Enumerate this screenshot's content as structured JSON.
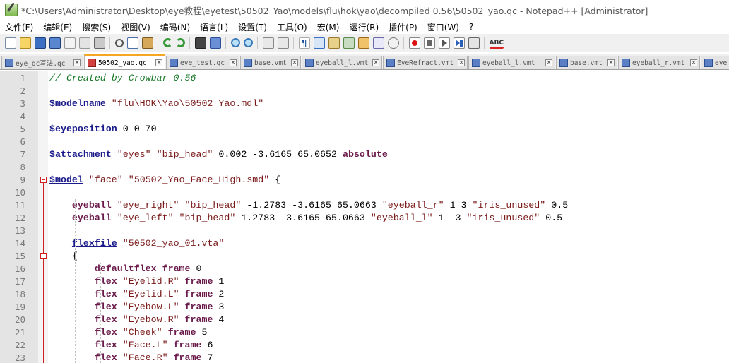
{
  "window": {
    "title": "*C:\\Users\\Administrator\\Desktop\\eye教程\\eyetest\\50502_Yao\\models\\flu\\hok\\yao\\decompiled 0.56\\50502_yao.qc - Notepad++ [Administrator]"
  },
  "menu": {
    "items": [
      "文件(F)",
      "编辑(E)",
      "搜索(S)",
      "视图(V)",
      "编码(N)",
      "语言(L)",
      "设置(T)",
      "工具(O)",
      "宏(M)",
      "运行(R)",
      "插件(P)",
      "窗口(W)",
      "?"
    ]
  },
  "toolbar": {
    "icons": [
      "new-file-icon",
      "open-file-icon",
      "save-icon",
      "save-all-icon",
      "close-icon",
      "close-all-icon",
      "print-icon",
      "cut-icon",
      "copy-icon",
      "paste-icon",
      "undo-icon",
      "redo-icon",
      "find-icon",
      "replace-icon",
      "zoom-in-icon",
      "zoom-out-icon",
      "sync-scroll-icon",
      "word-wrap-icon",
      "show-all-chars-icon",
      "indent-guide-icon",
      "folder-as-workspace-icon",
      "document-map-icon",
      "function-list-icon",
      "document-list-icon",
      "monitoring-icon",
      "record-macro-icon",
      "stop-recording-icon",
      "playback-macro-icon",
      "run-macro-multiple-icon",
      "save-macro-icon",
      "spell-check-icon"
    ],
    "spell_label": "ABC"
  },
  "tabs": [
    {
      "label": "eye_qc写法.qc",
      "active": false
    },
    {
      "label": "50502_yao.qc",
      "active": true
    },
    {
      "label": "eye_test.qc",
      "active": false
    },
    {
      "label": "base.vmt",
      "active": false
    },
    {
      "label": "eyeball_l.vmt",
      "active": false
    },
    {
      "label": "EyeRefract.vmt",
      "active": false
    },
    {
      "label": "eyeball_l.vmt",
      "active": false
    },
    {
      "label": "base.vmt",
      "active": false
    },
    {
      "label": "eyeball_r.vmt",
      "active": false
    },
    {
      "label": "eye",
      "active": false
    }
  ],
  "editor": {
    "lines": [
      {
        "n": "1",
        "tokens": [
          {
            "t": "// Created by Crowbar 0.56",
            "c": "comment"
          }
        ]
      },
      {
        "n": "2",
        "tokens": []
      },
      {
        "n": "3",
        "tokens": [
          {
            "t": "$modelname",
            "c": "dir"
          },
          {
            "t": " ",
            "c": "plain"
          },
          {
            "t": "\"flu\\HOK\\Yao\\50502_Yao.mdl\"",
            "c": "str"
          }
        ]
      },
      {
        "n": "4",
        "tokens": []
      },
      {
        "n": "5",
        "tokens": [
          {
            "t": "$eyeposition",
            "c": "dirnu"
          },
          {
            "t": " 0 0 70",
            "c": "num"
          }
        ]
      },
      {
        "n": "6",
        "tokens": []
      },
      {
        "n": "7",
        "tokens": [
          {
            "t": "$attachment",
            "c": "dirnu"
          },
          {
            "t": " ",
            "c": "plain"
          },
          {
            "t": "\"eyes\"",
            "c": "str"
          },
          {
            "t": " ",
            "c": "plain"
          },
          {
            "t": "\"bip_head\"",
            "c": "str"
          },
          {
            "t": " 0.002 -3.6165 65.0652 ",
            "c": "num"
          },
          {
            "t": "absolute",
            "c": "kw"
          }
        ]
      },
      {
        "n": "8",
        "tokens": []
      },
      {
        "n": "9",
        "tokens": [
          {
            "t": "$model",
            "c": "dir"
          },
          {
            "t": " ",
            "c": "plain"
          },
          {
            "t": "\"face\"",
            "c": "str"
          },
          {
            "t": " ",
            "c": "plain"
          },
          {
            "t": "\"50502_Yao_Face_High.smd\"",
            "c": "str"
          },
          {
            "t": " {",
            "c": "plain"
          }
        ]
      },
      {
        "n": "10",
        "tokens": []
      },
      {
        "n": "11",
        "tokens": [
          {
            "t": "    ",
            "c": "plain"
          },
          {
            "t": "eyeball",
            "c": "key"
          },
          {
            "t": " ",
            "c": "plain"
          },
          {
            "t": "\"eye_right\"",
            "c": "str"
          },
          {
            "t": " ",
            "c": "plain"
          },
          {
            "t": "\"bip_head\"",
            "c": "str"
          },
          {
            "t": " -1.2783 -3.6165 65.0663 ",
            "c": "num"
          },
          {
            "t": "\"eyeball_r\"",
            "c": "str"
          },
          {
            "t": " 1 3 ",
            "c": "num"
          },
          {
            "t": "\"iris_unused\"",
            "c": "str"
          },
          {
            "t": " 0.5",
            "c": "num"
          }
        ]
      },
      {
        "n": "12",
        "tokens": [
          {
            "t": "    ",
            "c": "plain"
          },
          {
            "t": "eyeball",
            "c": "key"
          },
          {
            "t": " ",
            "c": "plain"
          },
          {
            "t": "\"eye_left\"",
            "c": "str"
          },
          {
            "t": " ",
            "c": "plain"
          },
          {
            "t": "\"bip_head\"",
            "c": "str"
          },
          {
            "t": " 1.2783 -3.6165 65.0663 ",
            "c": "num"
          },
          {
            "t": "\"eyeball_l\"",
            "c": "str"
          },
          {
            "t": " 1 -3 ",
            "c": "num"
          },
          {
            "t": "\"iris_unused\"",
            "c": "str"
          },
          {
            "t": " 0.5",
            "c": "num"
          }
        ]
      },
      {
        "n": "13",
        "tokens": []
      },
      {
        "n": "14",
        "tokens": [
          {
            "t": "    ",
            "c": "plain"
          },
          {
            "t": "flexfile",
            "c": "dir"
          },
          {
            "t": " ",
            "c": "plain"
          },
          {
            "t": "\"50502_yao_01.vta\"",
            "c": "str"
          }
        ]
      },
      {
        "n": "15",
        "tokens": [
          {
            "t": "    {",
            "c": "plain"
          }
        ]
      },
      {
        "n": "16",
        "tokens": [
          {
            "t": "        ",
            "c": "plain"
          },
          {
            "t": "defaultflex",
            "c": "key"
          },
          {
            "t": " ",
            "c": "plain"
          },
          {
            "t": "frame",
            "c": "kw"
          },
          {
            "t": " 0",
            "c": "num"
          }
        ]
      },
      {
        "n": "17",
        "tokens": [
          {
            "t": "        ",
            "c": "plain"
          },
          {
            "t": "flex",
            "c": "key"
          },
          {
            "t": " ",
            "c": "plain"
          },
          {
            "t": "\"Eyelid.R\"",
            "c": "str"
          },
          {
            "t": " ",
            "c": "plain"
          },
          {
            "t": "frame",
            "c": "kw"
          },
          {
            "t": " 1",
            "c": "num"
          }
        ]
      },
      {
        "n": "18",
        "tokens": [
          {
            "t": "        ",
            "c": "plain"
          },
          {
            "t": "flex",
            "c": "key"
          },
          {
            "t": " ",
            "c": "plain"
          },
          {
            "t": "\"Eyelid.L\"",
            "c": "str"
          },
          {
            "t": " ",
            "c": "plain"
          },
          {
            "t": "frame",
            "c": "kw"
          },
          {
            "t": " 2",
            "c": "num"
          }
        ]
      },
      {
        "n": "19",
        "tokens": [
          {
            "t": "        ",
            "c": "plain"
          },
          {
            "t": "flex",
            "c": "key"
          },
          {
            "t": " ",
            "c": "plain"
          },
          {
            "t": "\"Eyebow.L\"",
            "c": "str"
          },
          {
            "t": " ",
            "c": "plain"
          },
          {
            "t": "frame",
            "c": "kw"
          },
          {
            "t": " 3",
            "c": "num"
          }
        ]
      },
      {
        "n": "20",
        "tokens": [
          {
            "t": "        ",
            "c": "plain"
          },
          {
            "t": "flex",
            "c": "key"
          },
          {
            "t": " ",
            "c": "plain"
          },
          {
            "t": "\"Eyebow.R\"",
            "c": "str"
          },
          {
            "t": " ",
            "c": "plain"
          },
          {
            "t": "frame",
            "c": "kw"
          },
          {
            "t": " 4",
            "c": "num"
          }
        ]
      },
      {
        "n": "21",
        "tokens": [
          {
            "t": "        ",
            "c": "plain"
          },
          {
            "t": "flex",
            "c": "key"
          },
          {
            "t": " ",
            "c": "plain"
          },
          {
            "t": "\"Cheek\"",
            "c": "str"
          },
          {
            "t": " ",
            "c": "plain"
          },
          {
            "t": "frame",
            "c": "kw"
          },
          {
            "t": " 5",
            "c": "num"
          }
        ]
      },
      {
        "n": "22",
        "tokens": [
          {
            "t": "        ",
            "c": "plain"
          },
          {
            "t": "flex",
            "c": "key"
          },
          {
            "t": " ",
            "c": "plain"
          },
          {
            "t": "\"Face.L\"",
            "c": "str"
          },
          {
            "t": " ",
            "c": "plain"
          },
          {
            "t": "frame",
            "c": "kw"
          },
          {
            "t": " 6",
            "c": "num"
          }
        ]
      },
      {
        "n": "23",
        "tokens": [
          {
            "t": "        ",
            "c": "plain"
          },
          {
            "t": "flex",
            "c": "key"
          },
          {
            "t": " ",
            "c": "plain"
          },
          {
            "t": "\"Face.R\"",
            "c": "str"
          },
          {
            "t": " ",
            "c": "plain"
          },
          {
            "t": "frame",
            "c": "kw"
          },
          {
            "t": " 7",
            "c": "num"
          }
        ]
      }
    ]
  },
  "colors": {
    "active_tab_accent": "#f5a623",
    "fold_marker": "#d02020",
    "comment": "#1a7a2a",
    "directive": "#1a1a8a",
    "string": "#7a1a1a",
    "keyword": "#6a1a4a"
  }
}
